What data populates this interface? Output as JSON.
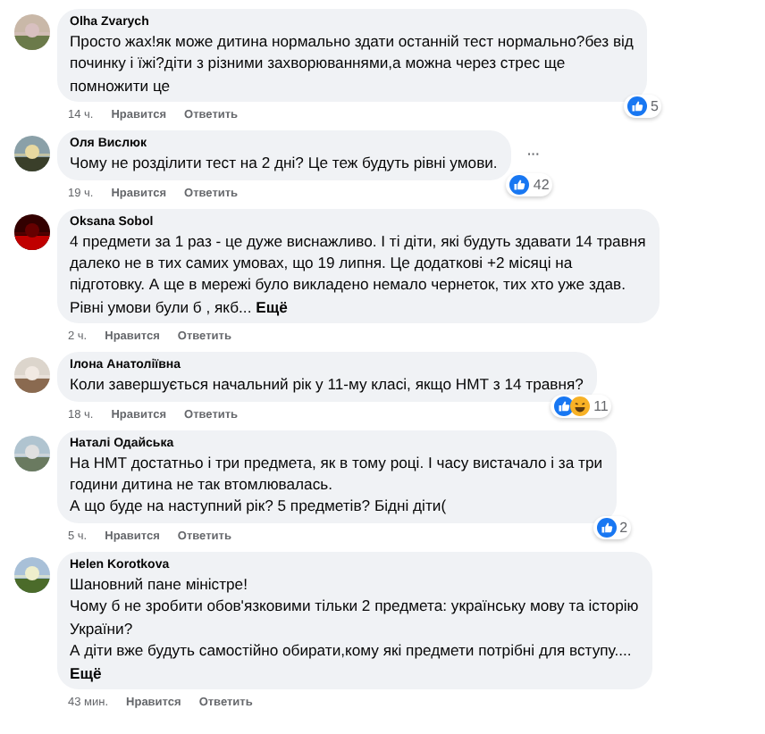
{
  "comments": [
    {
      "author": "Olha Zvarych",
      "text": "Просто жах!як може дитина нормально здати останній тест нормально?без від\nпочинку і їжі?діти з різними захворюваннями,а можна через стрес ще\nпомножити це",
      "time": "14 ч.",
      "like": "Нравится",
      "reply": "Ответить",
      "reactions": {
        "items": [
          {
            "kind": "like"
          }
        ],
        "count": "5"
      }
    },
    {
      "author": "Оля Вислюк",
      "text": "Чому не розділити тест на 2 дні? Це теж будуть рівні умови.",
      "time": "19 ч.",
      "like": "Нравится",
      "reply": "Ответить",
      "reactions": {
        "items": [
          {
            "kind": "like"
          }
        ],
        "count": "42"
      },
      "more": "···"
    },
    {
      "author": "Oksana Sobol",
      "text": "4 предмети за 1 раз - це дуже виснажливо. І ті діти, які будуть здавати 14 травня\nдалеко не в тих самих умовах, що 19 липня. Це додаткові +2 місяці на\nпідготовку. А ще в мережі було викладено немало чернеток, тих хто уже здав.\nРівні умови були б , якб... **Ещё**",
      "time": "2 ч.",
      "like": "Нравится",
      "reply": "Ответить"
    },
    {
      "author": "Ілона Анатоліївна",
      "text": "Коли завершується начальний рік у 11-му класі, якщо НМТ з 14 травня?",
      "time": "18 ч.",
      "like": "Нравится",
      "reply": "Ответить",
      "reactions": {
        "items": [
          {
            "kind": "like"
          },
          {
            "kind": "haha"
          }
        ],
        "count": "11"
      }
    },
    {
      "author": "Наталі Одайська",
      "text": "На НМТ достатньо і три предмета, як в тому році. І часу вистачало і за три\nгодини дитина не так втомлювалась.\nА що буде на наступний рік? 5 предметів? Бідні діти(",
      "time": "5 ч.",
      "like": "Нравится",
      "reply": "Ответить",
      "reactions": {
        "items": [
          {
            "kind": "like"
          }
        ],
        "count": "2"
      }
    },
    {
      "author": "Helen Korotkova",
      "text": "Шановний пане міністре!\nЧому б не зробити обов'язковими тільки 2 предмета: українську мову та історію\nУкраїни?\nА діти вже будуть самостійно обирати,кому які предмети потрібні для вступу....\n**Ещё**",
      "time": "43 мин.",
      "like": "Нравится",
      "reply": "Ответить"
    }
  ]
}
